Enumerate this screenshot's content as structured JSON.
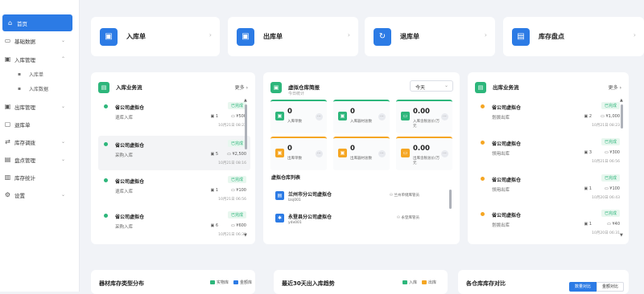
{
  "sidebar": {
    "items": [
      {
        "label": "首页",
        "icon": "home-icon",
        "glyph": "⌂"
      },
      {
        "label": "基础数据",
        "icon": "monitor-icon",
        "glyph": "▭"
      },
      {
        "label": "入库管理",
        "icon": "folder-in-icon",
        "glyph": "▣"
      },
      {
        "label": "出库管理",
        "icon": "folder-out-icon",
        "glyph": "▣"
      },
      {
        "label": "退库单",
        "icon": "document-icon",
        "glyph": "▢"
      },
      {
        "label": "库存调拨",
        "icon": "truck-icon",
        "glyph": "⇄"
      },
      {
        "label": "盘点管理",
        "icon": "clipboard-icon",
        "glyph": "▤"
      },
      {
        "label": "库存统计",
        "icon": "chart-icon",
        "glyph": "▥"
      },
      {
        "label": "设置",
        "icon": "gear-icon",
        "glyph": "⚙"
      }
    ],
    "subitems": [
      {
        "label": "入库单",
        "icon": "file-icon",
        "glyph": "▪"
      },
      {
        "label": "入库数据",
        "icon": "bar-chart-icon",
        "glyph": "▪"
      }
    ]
  },
  "quick": [
    {
      "label": "入库单",
      "glyph": "▣"
    },
    {
      "label": "出库单",
      "glyph": "▣"
    },
    {
      "label": "退库单",
      "glyph": "↻"
    },
    {
      "label": "库存盘点",
      "glyph": "▤"
    }
  ],
  "inbound": {
    "title": "入库业务流",
    "more": "更多",
    "rows": [
      {
        "name": "省公司虚拟仓",
        "type": "退库入库",
        "status": "已完成",
        "count": "1",
        "amount": "¥500",
        "time": "10月21日 08:22"
      },
      {
        "name": "省公司虚拟仓",
        "type": "采购入库",
        "status": "已完成",
        "count": "5",
        "amount": "¥2,500",
        "time": "10月21日 08:16"
      },
      {
        "name": "省公司虚拟仓",
        "type": "退库入库",
        "status": "已完成",
        "count": "1",
        "amount": "¥100",
        "time": "10月21日 06:56"
      },
      {
        "name": "省公司虚拟仓",
        "type": "采购入库",
        "status": "已完成",
        "count": "6",
        "amount": "¥600",
        "time": "10月21日 06:33"
      }
    ]
  },
  "virtual": {
    "title": "虚拟仓库简报",
    "subtitle": "今日统计",
    "select": "今天",
    "stats": [
      {
        "value": "0",
        "label": "入库单数"
      },
      {
        "value": "0",
        "label": "入库器材总数"
      },
      {
        "value": "0.00",
        "label": "入库含税总价/万元"
      },
      {
        "value": "0",
        "label": "出库单数"
      },
      {
        "value": "0",
        "label": "出库器材总数"
      },
      {
        "value": "0.00",
        "label": "出库含税总价/万元"
      }
    ],
    "list_title": "虚拟仓库列表",
    "warehouses": [
      {
        "name": "兰州市分公司虚拟仓",
        "code": "lzsj001",
        "manager": "兰州单储库管员"
      },
      {
        "name": "永登县分公司虚拟仓",
        "code": "ydx001",
        "manager": "永登库管员"
      }
    ]
  },
  "outbound": {
    "title": "出库业务流",
    "more": "更多",
    "rows": [
      {
        "name": "省公司虚拟仓",
        "type": "划拨出库",
        "status": "已完成",
        "count": "2",
        "amount": "¥1,000",
        "time": "10月21日 08:23"
      },
      {
        "name": "省公司虚拟仓",
        "type": "领用出库",
        "status": "已完成",
        "count": "3",
        "amount": "¥300",
        "time": "10月21日 06:56"
      },
      {
        "name": "省公司虚拟仓",
        "type": "领用出库",
        "status": "已完成",
        "count": "1",
        "amount": "¥100",
        "time": "10月20日 06:43"
      },
      {
        "name": "省公司虚拟仓",
        "type": "划拨出库",
        "status": "已完成",
        "count": "1",
        "amount": "¥40",
        "time": "10月20日 06:31"
      }
    ]
  },
  "bottom": {
    "c1": {
      "title": "器材库存类型分布",
      "legend": [
        {
          "label": "实物库",
          "color": "#2db67b"
        },
        {
          "label": "金额库",
          "color": "#2c7be5"
        }
      ]
    },
    "c2": {
      "title": "最近30天出入库趋势",
      "legend": [
        {
          "label": "入库",
          "color": "#2db67b"
        },
        {
          "label": "出库",
          "color": "#f5a623"
        }
      ]
    },
    "c3": {
      "title": "各仓库库存对比",
      "tab_active": "数量对比",
      "tab_other": "金额对比"
    }
  },
  "colors": {
    "primary": "#2c7be5",
    "green": "#2db67b",
    "orange": "#f5a623"
  }
}
